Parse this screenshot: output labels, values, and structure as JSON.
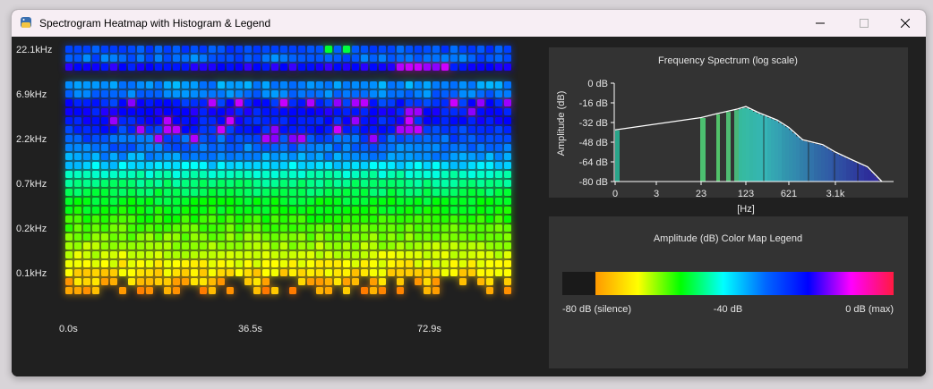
{
  "window": {
    "title": "Spectrogram Heatmap with Histogram & Legend",
    "controls": {
      "minimize": "minimize",
      "maximize": "maximize",
      "close": "close"
    }
  },
  "heatmap": {
    "y_labels": [
      "22.1kHz",
      "6.9kHz",
      "2.2kHz",
      "0.7kHz",
      "0.2kHz",
      "0.1kHz"
    ],
    "x_labels": [
      "0.0s",
      "36.5s",
      "72.9s"
    ]
  },
  "spectrum": {
    "title": "Frequency Spectrum (log scale)",
    "ylabel": "Amplitude (dB)",
    "xlabel": "[Hz]",
    "y_ticks": [
      "0 dB",
      "-16 dB",
      "-32 dB",
      "-48 dB",
      "-64 dB",
      "-80 dB"
    ],
    "x_ticks": [
      "0",
      "3",
      "23",
      "123",
      "621",
      "3.1k"
    ]
  },
  "legend": {
    "title": "Amplitude (dB) Color Map Legend",
    "labels": [
      "-80 dB (silence)",
      "-40 dB",
      "0 dB (max)"
    ],
    "colors": [
      "#1a1a1a",
      "#ff9900",
      "#ffff00",
      "#00ff00",
      "#00ffff",
      "#0066ff",
      "#0000ff",
      "#ff00ff",
      "#ff1a40"
    ]
  },
  "chart_data": [
    {
      "type": "heatmap",
      "xlabel": "",
      "ylabel": "",
      "x_ticks": [
        "0.0s",
        "36.5s",
        "72.9s"
      ],
      "y_ticks": [
        "22.1kHz",
        "6.9kHz",
        "2.2kHz",
        "0.7kHz",
        "0.2kHz",
        "0.1kHz"
      ],
      "columns": 50,
      "rows": 28,
      "value_range_db": [
        -80,
        0
      ]
    },
    {
      "type": "area",
      "title": "Frequency Spectrum (log scale)",
      "ylabel": "Amplitude (dB)",
      "xlabel": "[Hz]",
      "ylim": [
        -80,
        0
      ],
      "x": [
        0.5,
        23,
        40,
        60,
        90,
        123,
        200,
        400,
        621,
        1000,
        2000,
        3100,
        6000,
        12000,
        22000
      ],
      "y": [
        -38,
        -28,
        -25,
        -23,
        -21,
        -19,
        -24,
        -30,
        -36,
        -46,
        -50,
        -56,
        -62,
        -68,
        -80
      ]
    }
  ]
}
